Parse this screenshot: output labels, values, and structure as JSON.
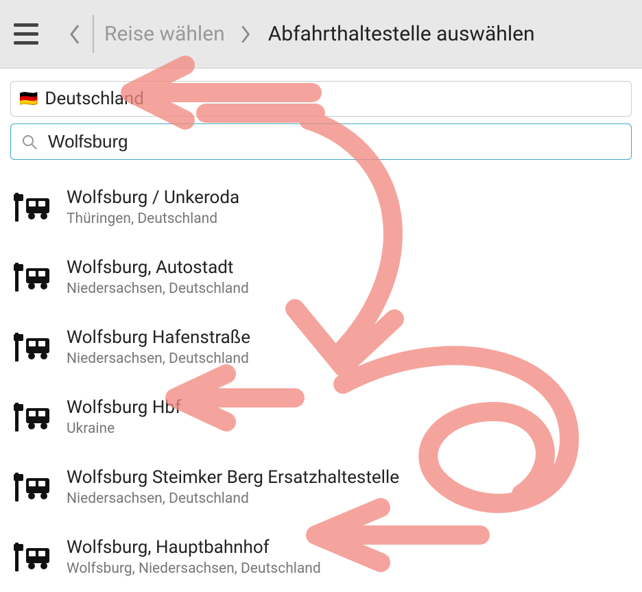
{
  "header": {
    "breadcrumb_prev": "Reise wählen",
    "breadcrumb_current": "Abfahrthaltestelle auswählen"
  },
  "country": {
    "flag": "🇩🇪",
    "label": "Deutschland"
  },
  "search": {
    "value": "Wolfsburg",
    "placeholder": ""
  },
  "results": [
    {
      "title": "Wolfsburg / Unkeroda",
      "subtitle": "Thüringen, Deutschland"
    },
    {
      "title": "Wolfsburg, Autostadt",
      "subtitle": "Niedersachsen, Deutschland"
    },
    {
      "title": "Wolfsburg Hafenstraße",
      "subtitle": "Niedersachsen, Deutschland"
    },
    {
      "title": "Wolfsburg Hbf",
      "subtitle": "Ukraine"
    },
    {
      "title": "Wolfsburg Steimker Berg Ersatzhaltestelle",
      "subtitle": "Niedersachsen, Deutschland"
    },
    {
      "title": "Wolfsburg, Hauptbahnhof",
      "subtitle": "Wolfsburg, Niedersachsen, Deutschland"
    }
  ],
  "annotation_color": "#f28b82"
}
